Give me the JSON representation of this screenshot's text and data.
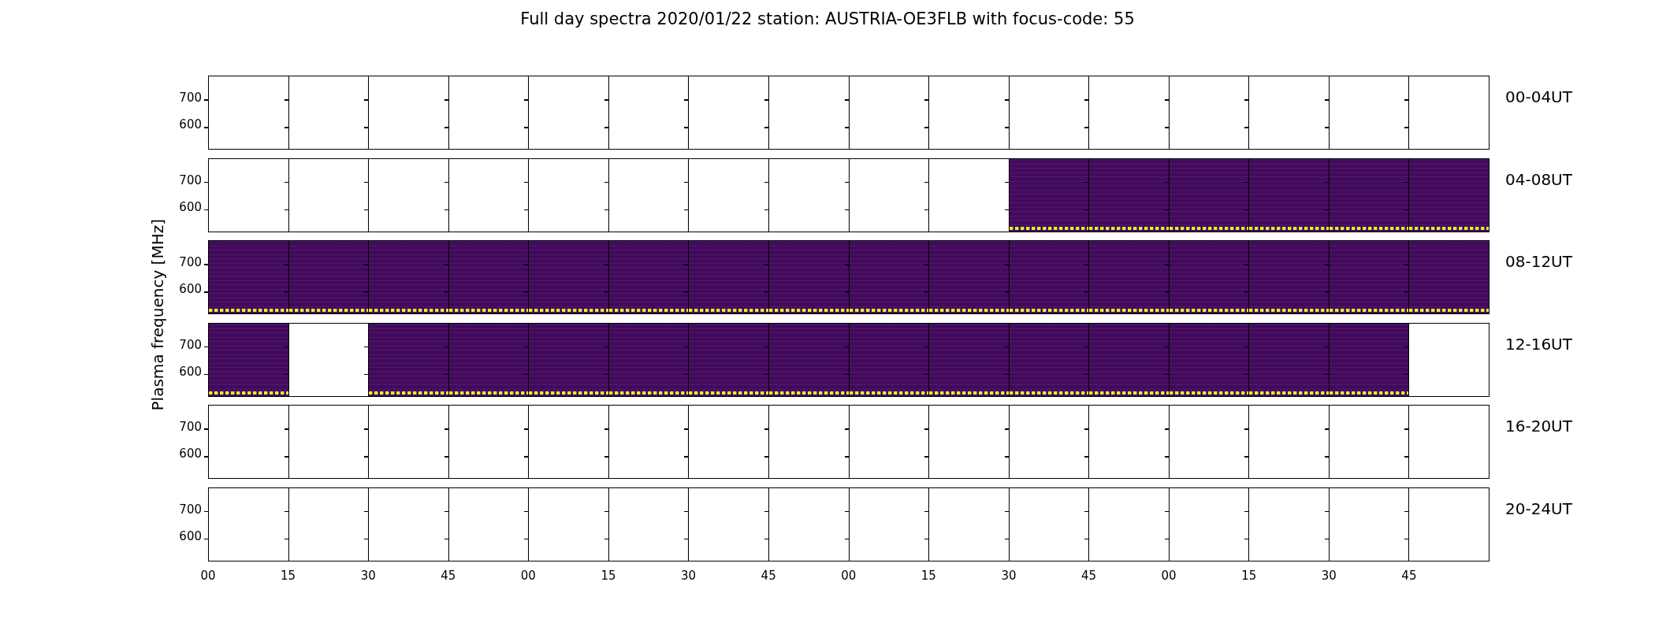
{
  "title": "Full day spectra 2020/01/22 station: AUSTRIA-OE3FLB with focus-code: 55",
  "y_axis_label": "Plasma frequency [MHz]",
  "rows": [
    {
      "label": "00-04UT",
      "y_ticks": [
        "700",
        "600"
      ],
      "panels": [
        {
          "filled": false
        },
        {
          "filled": false
        },
        {
          "filled": false
        },
        {
          "filled": false
        },
        {
          "filled": false
        },
        {
          "filled": false
        },
        {
          "filled": false
        },
        {
          "filled": false
        },
        {
          "filled": false
        },
        {
          "filled": false
        },
        {
          "filled": false
        },
        {
          "filled": false
        },
        {
          "filled": false
        },
        {
          "filled": false
        },
        {
          "filled": false
        },
        {
          "filled": false
        }
      ]
    },
    {
      "label": "04-08UT",
      "y_ticks": [
        "700",
        "600"
      ],
      "panels": [
        {
          "filled": false
        },
        {
          "filled": false
        },
        {
          "filled": false
        },
        {
          "filled": false
        },
        {
          "filled": false
        },
        {
          "filled": false
        },
        {
          "filled": false
        },
        {
          "filled": false
        },
        {
          "filled": false
        },
        {
          "filled": false
        },
        {
          "filled": true
        },
        {
          "filled": true
        },
        {
          "filled": true
        },
        {
          "filled": true
        },
        {
          "filled": true
        },
        {
          "filled": true
        }
      ]
    },
    {
      "label": "08-12UT",
      "y_ticks": [
        "700",
        "600"
      ],
      "panels": [
        {
          "filled": true
        },
        {
          "filled": true
        },
        {
          "filled": true
        },
        {
          "filled": true
        },
        {
          "filled": true
        },
        {
          "filled": true
        },
        {
          "filled": true
        },
        {
          "filled": true
        },
        {
          "filled": true
        },
        {
          "filled": true
        },
        {
          "filled": true
        },
        {
          "filled": true
        },
        {
          "filled": true
        },
        {
          "filled": true
        },
        {
          "filled": true
        },
        {
          "filled": true
        }
      ]
    },
    {
      "label": "12-16UT",
      "y_ticks": [
        "700",
        "600"
      ],
      "panels": [
        {
          "filled": true
        },
        {
          "filled": false
        },
        {
          "filled": true
        },
        {
          "filled": true
        },
        {
          "filled": true
        },
        {
          "filled": true
        },
        {
          "filled": true
        },
        {
          "filled": true
        },
        {
          "filled": true
        },
        {
          "filled": true
        },
        {
          "filled": true
        },
        {
          "filled": true
        },
        {
          "filled": true
        },
        {
          "filled": true
        },
        {
          "filled": true
        },
        {
          "filled": false
        }
      ]
    },
    {
      "label": "16-20UT",
      "y_ticks": [
        "700",
        "600"
      ],
      "panels": [
        {
          "filled": false
        },
        {
          "filled": false
        },
        {
          "filled": false
        },
        {
          "filled": false
        },
        {
          "filled": false
        },
        {
          "filled": false
        },
        {
          "filled": false
        },
        {
          "filled": false
        },
        {
          "filled": false
        },
        {
          "filled": false
        },
        {
          "filled": false
        },
        {
          "filled": false
        },
        {
          "filled": false
        },
        {
          "filled": false
        },
        {
          "filled": false
        },
        {
          "filled": false
        }
      ]
    },
    {
      "label": "20-24UT",
      "y_ticks": [
        "700",
        "600"
      ],
      "panels": [
        {
          "filled": false
        },
        {
          "filled": false
        },
        {
          "filled": false
        },
        {
          "filled": false
        },
        {
          "filled": false
        },
        {
          "filled": false
        },
        {
          "filled": false
        },
        {
          "filled": false
        },
        {
          "filled": false
        },
        {
          "filled": false
        },
        {
          "filled": false
        },
        {
          "filled": false
        },
        {
          "filled": false
        },
        {
          "filled": false
        },
        {
          "filled": false
        },
        {
          "filled": false
        }
      ]
    }
  ],
  "x_ticks": [
    "00",
    "15",
    "30",
    "45",
    "00",
    "15",
    "30",
    "45",
    "00",
    "15",
    "30",
    "45",
    "00",
    "15",
    "30",
    "45"
  ]
}
